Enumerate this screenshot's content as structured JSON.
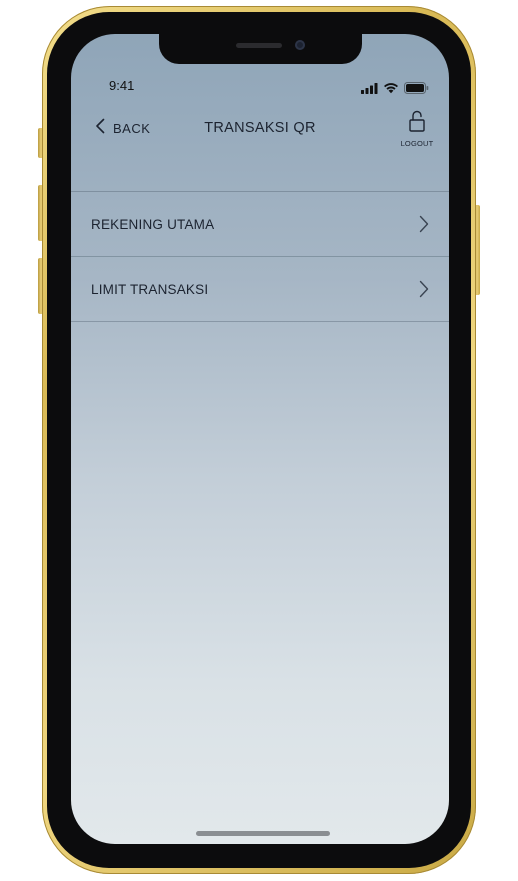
{
  "status_bar": {
    "time": "9:41",
    "signal_icon": "cellular-signal-icon",
    "wifi_icon": "wifi-icon",
    "battery_icon": "battery-icon"
  },
  "nav": {
    "back_label": "BACK",
    "back_icon": "chevron-left-icon",
    "title": "TRANSAKSI QR",
    "logout_label": "LOGOUT",
    "logout_icon": "unlock-icon"
  },
  "menu": {
    "items": [
      {
        "label": "REKENING UTAMA",
        "icon": "chevron-right-icon"
      },
      {
        "label": "LIMIT TRANSAKSI",
        "icon": "chevron-right-icon"
      }
    ]
  },
  "colors": {
    "frame_gold": "#e3c86a",
    "text_dark": "#1c2330",
    "screen_top": "#8fa5b8",
    "screen_bottom": "#e2e8eb"
  }
}
